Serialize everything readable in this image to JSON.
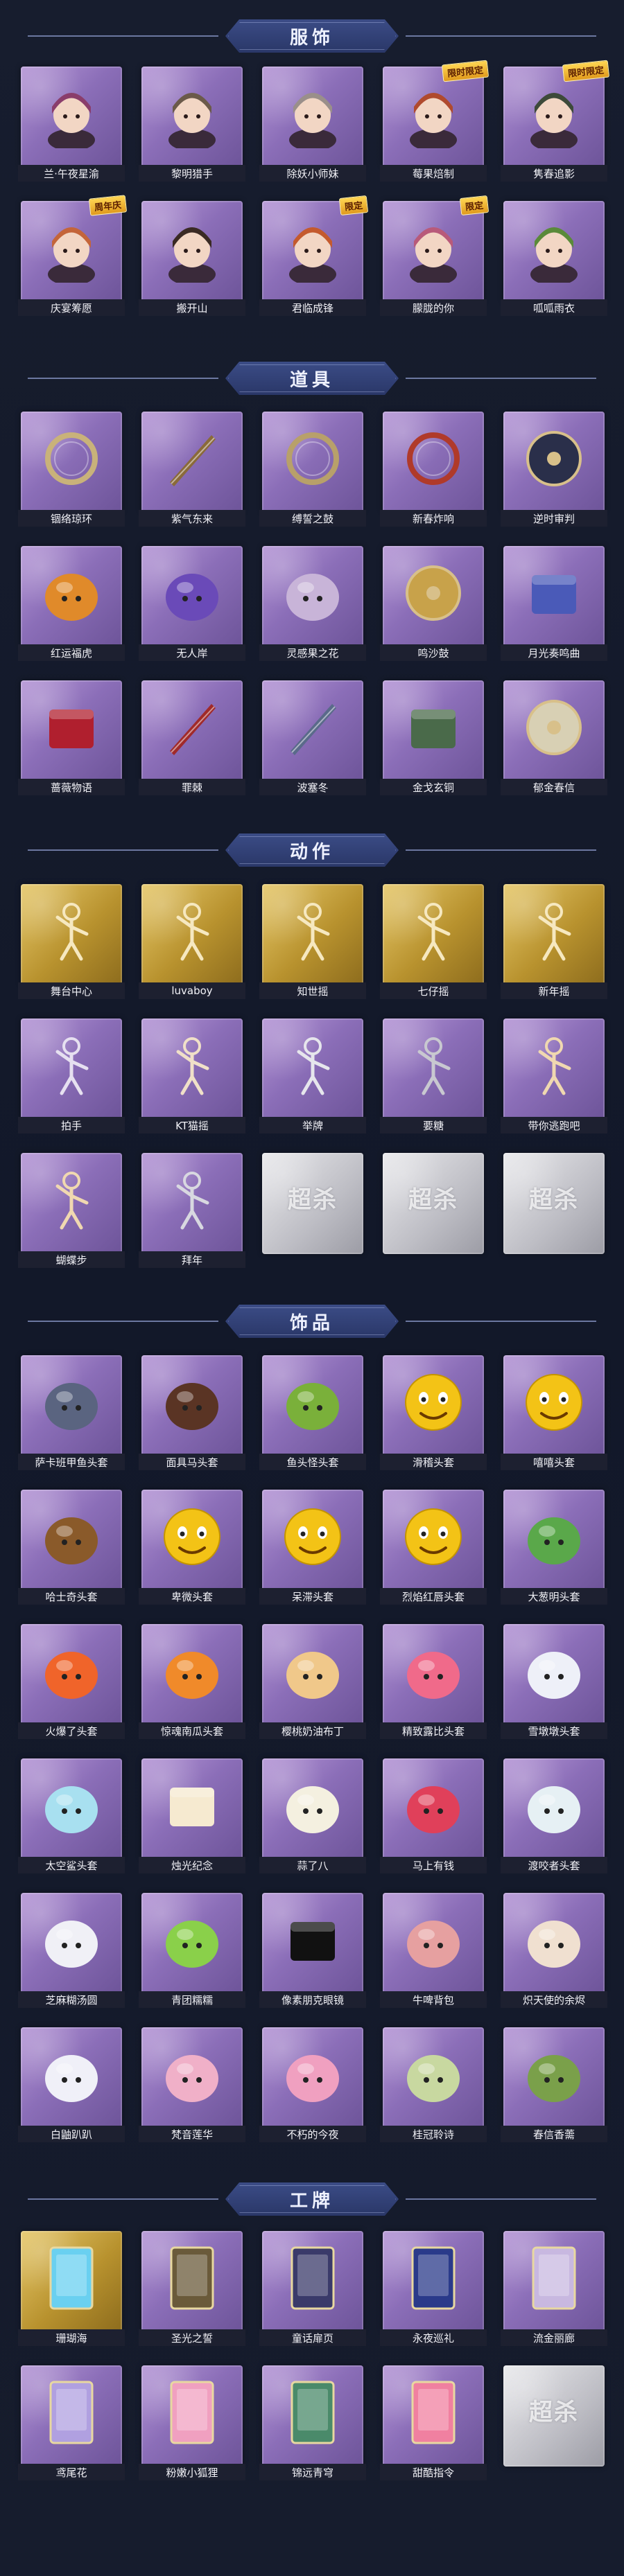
{
  "sections": [
    {
      "title": "服饰",
      "items": [
        {
          "label": "兰·午夜星渝",
          "icon": "character-portrait-icon",
          "tile": "purple",
          "art": "char",
          "hue": "#8a3d6b"
        },
        {
          "label": "黎明猎手",
          "icon": "character-portrait-icon",
          "tile": "purple",
          "art": "char",
          "hue": "#6b5a4a"
        },
        {
          "label": "除妖小师妹",
          "icon": "character-portrait-icon",
          "tile": "purple",
          "art": "char",
          "hue": "#9a8f8a"
        },
        {
          "label": "莓果焙制",
          "icon": "character-portrait-icon",
          "tile": "purple",
          "art": "char",
          "hue": "#b04a2e",
          "badge": "限时限定"
        },
        {
          "label": "隽春追影",
          "icon": "character-portrait-icon",
          "tile": "purple",
          "art": "char",
          "hue": "#3d4a3a",
          "badge": "限时限定"
        },
        {
          "label": "庆宴筹愿",
          "icon": "character-portrait-icon",
          "tile": "purple",
          "art": "char",
          "hue": "#c4653a",
          "badge": "周年庆"
        },
        {
          "label": "搬开山",
          "icon": "character-portrait-icon",
          "tile": "purple",
          "art": "char",
          "hue": "#3a2a24"
        },
        {
          "label": "君临成锋",
          "icon": "character-portrait-icon",
          "tile": "purple",
          "art": "char",
          "hue": "#c45a2e",
          "badge": "限定"
        },
        {
          "label": "朦胧的你",
          "icon": "character-portrait-icon",
          "tile": "purple",
          "art": "char",
          "hue": "#b85a7a",
          "badge": "限定"
        },
        {
          "label": "呱呱雨衣",
          "icon": "character-portrait-icon",
          "tile": "purple",
          "art": "char",
          "hue": "#5a8a3a"
        }
      ]
    },
    {
      "title": "道具",
      "items": [
        {
          "label": "锢络琼环",
          "icon": "ring-prop-icon",
          "tile": "purple",
          "art": "ring",
          "hue": "#c9b27a"
        },
        {
          "label": "紫气东来",
          "icon": "sword-prop-icon",
          "tile": "purple",
          "art": "blade",
          "hue": "#8a6a3a"
        },
        {
          "label": "缚誓之鼓",
          "icon": "whip-prop-icon",
          "tile": "purple",
          "art": "ring",
          "hue": "#b8a06a"
        },
        {
          "label": "新春炸响",
          "icon": "firecracker-prop-icon",
          "tile": "purple",
          "art": "ring",
          "hue": "#b03a2a"
        },
        {
          "label": "逆时审判",
          "icon": "clock-prop-icon",
          "tile": "purple",
          "art": "disc",
          "hue": "#2a2f4a"
        },
        {
          "label": "红运福虎",
          "icon": "tiger-prop-icon",
          "tile": "purple",
          "art": "blob",
          "hue": "#e08a2a"
        },
        {
          "label": "无人岸",
          "icon": "drone-prop-icon",
          "tile": "purple",
          "art": "blob",
          "hue": "#6a4ab8"
        },
        {
          "label": "灵感果之花",
          "icon": "bouquet-prop-icon",
          "tile": "purple",
          "art": "blob",
          "hue": "#c8b4d8"
        },
        {
          "label": "鸣沙鼓",
          "icon": "drum-prop-icon",
          "tile": "purple",
          "art": "disc",
          "hue": "#c8a24a"
        },
        {
          "label": "月光奏鸣曲",
          "icon": "piano-prop-icon",
          "tile": "purple",
          "art": "box",
          "hue": "#4a5ab8"
        },
        {
          "label": "蔷薇物语",
          "icon": "medkit-prop-icon",
          "tile": "purple",
          "art": "box",
          "hue": "#b01f2e"
        },
        {
          "label": "罪棘",
          "icon": "spear-prop-icon",
          "tile": "purple",
          "art": "blade",
          "hue": "#a02a2a"
        },
        {
          "label": "波塞冬",
          "icon": "trident-prop-icon",
          "tile": "purple",
          "art": "blade",
          "hue": "#5a6a8a"
        },
        {
          "label": "金戈玄铜",
          "icon": "lantern-prop-icon",
          "tile": "purple",
          "art": "box",
          "hue": "#4a6a4a"
        },
        {
          "label": "郁金春信",
          "icon": "fan-prop-icon",
          "tile": "purple",
          "art": "disc",
          "hue": "#d8d0b4"
        }
      ]
    },
    {
      "title": "动作",
      "items": [
        {
          "label": "舞台中心",
          "icon": "dance-pose-icon",
          "tile": "gold",
          "art": "pose",
          "hue": "#f6e8c0"
        },
        {
          "label": "luvaboy",
          "icon": "dance-pose-icon",
          "tile": "gold",
          "art": "pose",
          "hue": "#f6e8c0"
        },
        {
          "label": "知世摇",
          "icon": "dance-pose-icon",
          "tile": "gold",
          "art": "pose",
          "hue": "#f6e8c0"
        },
        {
          "label": "七仔摇",
          "icon": "dance-pose-icon",
          "tile": "gold",
          "art": "pose",
          "hue": "#f6e8c0"
        },
        {
          "label": "新年摇",
          "icon": "dance-pose-icon",
          "tile": "gold",
          "art": "pose",
          "hue": "#f6e8c0"
        },
        {
          "label": "拍手",
          "icon": "clap-pose-icon",
          "tile": "purple",
          "art": "pose",
          "hue": "#e6e0f0"
        },
        {
          "label": "KT猫摇",
          "icon": "dance-pose-icon",
          "tile": "purple",
          "art": "pose",
          "hue": "#f0e0c8"
        },
        {
          "label": "举牌",
          "icon": "sign-pose-icon",
          "tile": "purple",
          "art": "pose",
          "hue": "#e6e6ec"
        },
        {
          "label": "要糖",
          "icon": "candy-pose-icon",
          "tile": "purple",
          "art": "pose",
          "hue": "#c8c8d0"
        },
        {
          "label": "带你逃跑吧",
          "icon": "run-pose-icon",
          "tile": "purple",
          "art": "pose",
          "hue": "#f0d8b0"
        },
        {
          "label": "蝴蝶步",
          "icon": "butterfly-pose-icon",
          "tile": "purple",
          "art": "pose",
          "hue": "#f0d8b0"
        },
        {
          "label": "拜年",
          "icon": "bow-pose-icon",
          "tile": "purple",
          "art": "pose",
          "hue": "#d8d8e0"
        },
        {
          "label": "",
          "icon": "placeholder-logo-icon",
          "tile": "grey",
          "art": "stamp",
          "stamp": "超杀"
        },
        {
          "label": "",
          "icon": "placeholder-logo-icon",
          "tile": "grey",
          "art": "stamp",
          "stamp": "超杀"
        },
        {
          "label": "",
          "icon": "placeholder-logo-icon",
          "tile": "grey",
          "art": "stamp",
          "stamp": "超杀"
        }
      ]
    },
    {
      "title": "饰品",
      "items": [
        {
          "label": "萨卡班甲鱼头套",
          "icon": "fish-head-icon",
          "tile": "purple",
          "art": "blob",
          "hue": "#5a6480"
        },
        {
          "label": "面具马头套",
          "icon": "horse-head-icon",
          "tile": "purple",
          "art": "blob",
          "hue": "#5a3424"
        },
        {
          "label": "鱼头怪头套",
          "icon": "fish-monster-head-icon",
          "tile": "purple",
          "art": "blob",
          "hue": "#7ab03a"
        },
        {
          "label": "滑稽头套",
          "icon": "funny-face-head-icon",
          "tile": "purple",
          "art": "face",
          "hue": "#f3c316"
        },
        {
          "label": "嘻嘻头套",
          "icon": "grin-face-head-icon",
          "tile": "purple",
          "art": "face",
          "hue": "#f3c316"
        },
        {
          "label": "哈士奇头套",
          "icon": "husky-head-icon",
          "tile": "purple",
          "art": "blob",
          "hue": "#8a5a2a"
        },
        {
          "label": "卑微头套",
          "icon": "humble-face-head-icon",
          "tile": "purple",
          "art": "face",
          "hue": "#f3c316"
        },
        {
          "label": "呆滞头套",
          "icon": "dull-face-head-icon",
          "tile": "purple",
          "art": "face",
          "hue": "#f3c316"
        },
        {
          "label": "烈焰红唇头套",
          "icon": "red-lips-head-icon",
          "tile": "purple",
          "art": "face",
          "hue": "#f3c316"
        },
        {
          "label": "大葱明头套",
          "icon": "scallion-head-icon",
          "tile": "purple",
          "art": "blob",
          "hue": "#5aa84a"
        },
        {
          "label": "火爆了头套",
          "icon": "fire-head-icon",
          "tile": "purple",
          "art": "blob",
          "hue": "#f0642a"
        },
        {
          "label": "惊魂南瓜头套",
          "icon": "pumpkin-head-icon",
          "tile": "purple",
          "art": "blob",
          "hue": "#f08a2a"
        },
        {
          "label": "樱桃奶油布丁",
          "icon": "pudding-head-icon",
          "tile": "purple",
          "art": "blob",
          "hue": "#f0c88a"
        },
        {
          "label": "精致露比头套",
          "icon": "ruby-head-icon",
          "tile": "purple",
          "art": "blob",
          "hue": "#f06a8a"
        },
        {
          "label": "雪墩墩头套",
          "icon": "snow-head-icon",
          "tile": "purple",
          "art": "blob",
          "hue": "#eef0f8"
        },
        {
          "label": "太空鲨头套",
          "icon": "space-shark-head-icon",
          "tile": "purple",
          "art": "blob",
          "hue": "#a8e0f0"
        },
        {
          "label": "烛光纪念",
          "icon": "candle-icon",
          "tile": "purple",
          "art": "box",
          "hue": "#f6ead0"
        },
        {
          "label": "蒜了八",
          "icon": "garlic-icon",
          "tile": "purple",
          "art": "blob",
          "hue": "#f4f0e0"
        },
        {
          "label": "马上有钱",
          "icon": "horse-money-icon",
          "tile": "purple",
          "art": "blob",
          "hue": "#e0405a"
        },
        {
          "label": "渡咬者头套",
          "icon": "cloud-head-icon",
          "tile": "purple",
          "art": "blob",
          "hue": "#e6f0f4"
        },
        {
          "label": "芝麻糊汤圆",
          "icon": "dumpling-icon",
          "tile": "purple",
          "art": "blob",
          "hue": "#f0f0f6"
        },
        {
          "label": "青团糯糯",
          "icon": "green-dumpling-icon",
          "tile": "purple",
          "art": "blob",
          "hue": "#8ad04a"
        },
        {
          "label": "像素朋克眼镜",
          "icon": "pixel-glasses-icon",
          "tile": "purple",
          "art": "box",
          "hue": "#111111"
        },
        {
          "label": "牛啤背包",
          "icon": "backpack-icon",
          "tile": "purple",
          "art": "blob",
          "hue": "#e6a0a0"
        },
        {
          "label": "炽天使的余烬",
          "icon": "angel-doll-icon",
          "tile": "purple",
          "art": "blob",
          "hue": "#f0e0d0"
        },
        {
          "label": "白鼬趴趴",
          "icon": "ferret-icon",
          "tile": "purple",
          "art": "blob",
          "hue": "#f0f0f8"
        },
        {
          "label": "梵音莲华",
          "icon": "lotus-doll-icon",
          "tile": "purple",
          "art": "blob",
          "hue": "#f0b0c8"
        },
        {
          "label": "不朽的今夜",
          "icon": "pink-doll-icon",
          "tile": "purple",
          "art": "blob",
          "hue": "#f0a0c0"
        },
        {
          "label": "桂冠聆诗",
          "icon": "laurel-doll-icon",
          "tile": "purple",
          "art": "blob",
          "hue": "#c8d8a0"
        },
        {
          "label": "春信香薷",
          "icon": "herb-doll-icon",
          "tile": "purple",
          "art": "blob",
          "hue": "#7aa04a"
        }
      ]
    },
    {
      "title": "工牌",
      "items": [
        {
          "label": "珊瑚海",
          "icon": "coral-sea-badge-icon",
          "tile": "gold",
          "art": "card",
          "hue": "#6ad0f0"
        },
        {
          "label": "圣光之誓",
          "icon": "holy-light-badge-icon",
          "tile": "purple",
          "art": "card",
          "hue": "#6a5a3a"
        },
        {
          "label": "童话扉页",
          "icon": "fairy-page-badge-icon",
          "tile": "purple",
          "art": "card",
          "hue": "#3a3a6a"
        },
        {
          "label": "永夜巡礼",
          "icon": "night-badge-icon",
          "tile": "purple",
          "art": "card",
          "hue": "#2a3a8a"
        },
        {
          "label": "流金丽廊",
          "icon": "gold-corridor-badge-icon",
          "tile": "purple",
          "art": "card",
          "hue": "#c8b8e0"
        },
        {
          "label": "鸢尾花",
          "icon": "iris-badge-icon",
          "tile": "purple",
          "art": "card",
          "hue": "#b0a0e0"
        },
        {
          "label": "粉嫩小狐狸",
          "icon": "pink-fox-badge-icon",
          "tile": "purple",
          "art": "card",
          "hue": "#f0a0c0"
        },
        {
          "label": "锦远青穹",
          "icon": "blue-sky-badge-icon",
          "tile": "purple",
          "art": "card",
          "hue": "#4a8a6a"
        },
        {
          "label": "甜酷指令",
          "icon": "sweet-cool-badge-icon",
          "tile": "purple",
          "art": "card",
          "hue": "#f080a0"
        },
        {
          "label": "",
          "icon": "placeholder-logo-icon",
          "tile": "grey",
          "art": "stamp",
          "stamp": "超杀"
        }
      ]
    }
  ]
}
